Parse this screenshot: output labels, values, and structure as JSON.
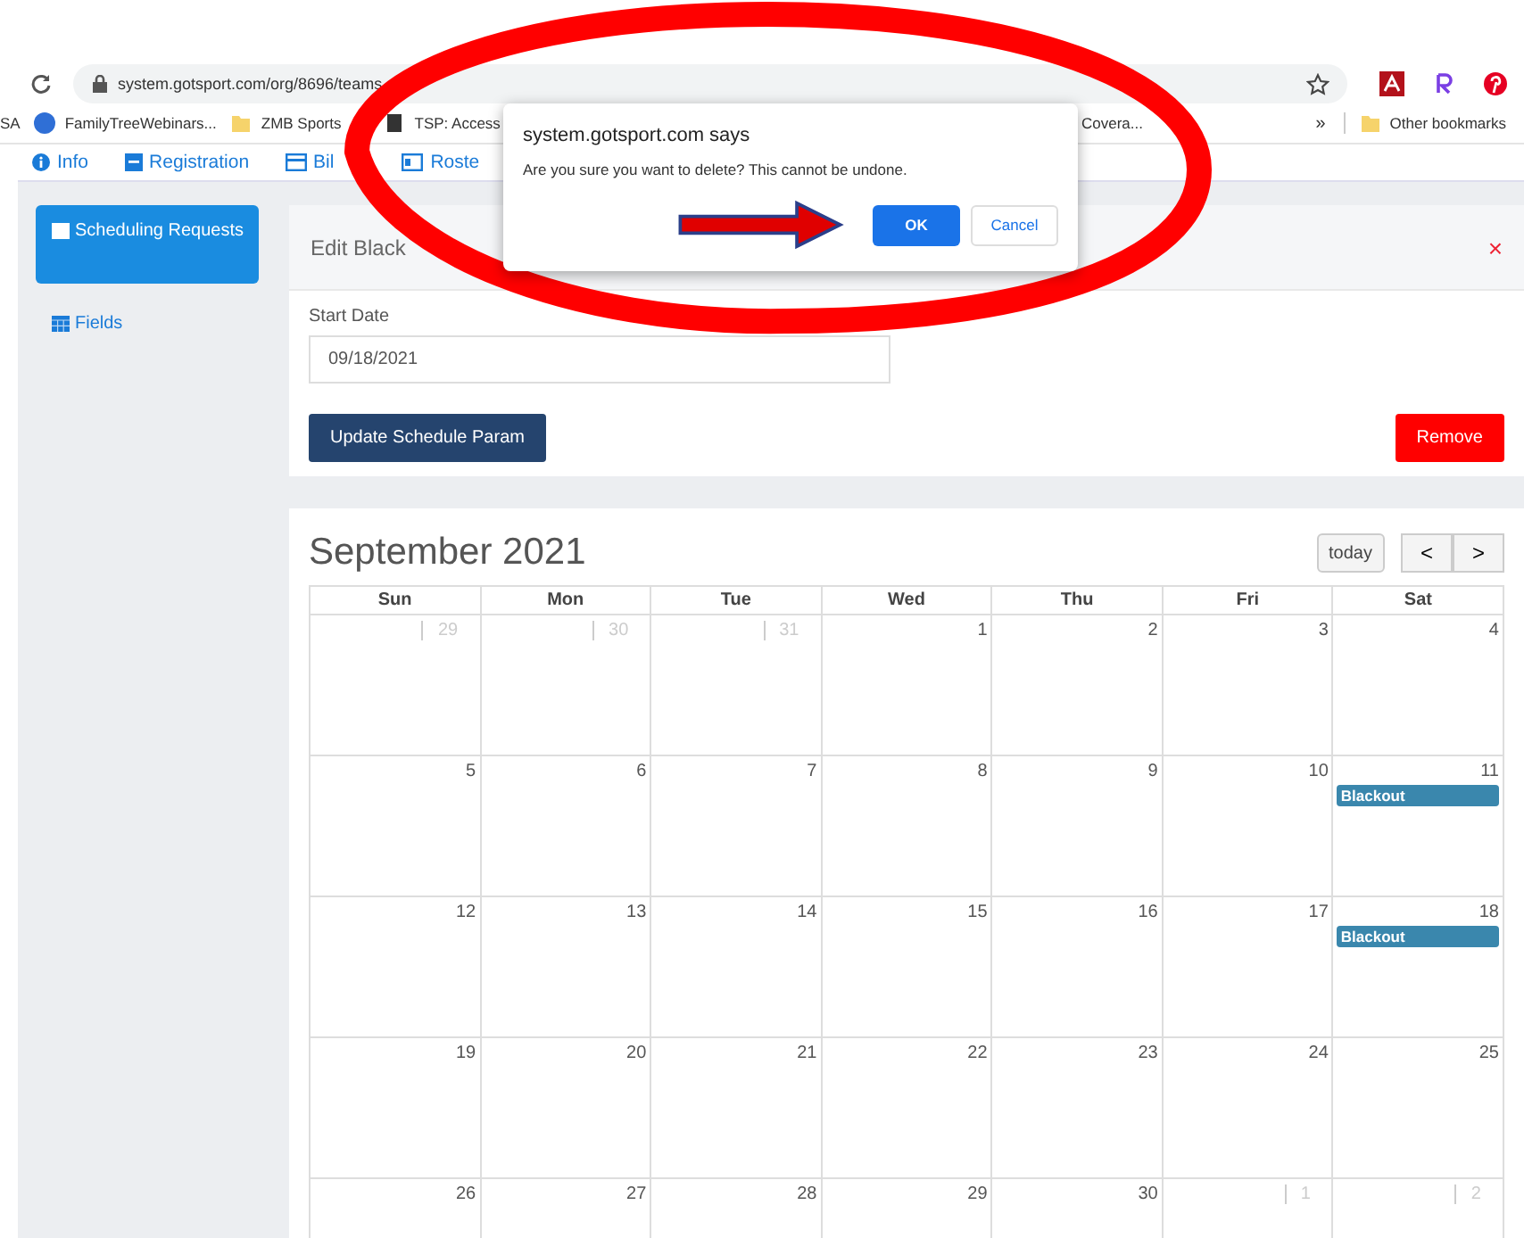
{
  "browser": {
    "url": "system.gotsport.com/org/8696/teams",
    "bookmarks": [
      {
        "label": "SA",
        "kind": "text"
      },
      {
        "label": "FamilyTreeWebinars...",
        "kind": "circle"
      },
      {
        "label": "ZMB Sports",
        "kind": "folder"
      },
      {
        "label": "TSP: Access",
        "kind": "page"
      }
    ],
    "bookmarks_right": [
      {
        "label": "Covera..."
      }
    ],
    "more": "»",
    "other_bookmarks": "Other bookmarks"
  },
  "nav_tabs": [
    {
      "label": "Info"
    },
    {
      "label": "Registration"
    },
    {
      "label": "Bil"
    },
    {
      "label": "Roste"
    }
  ],
  "sidebar": {
    "items": [
      {
        "label": "Scheduling Requests",
        "selected": true
      },
      {
        "label": "Fields",
        "selected": false
      }
    ]
  },
  "edit_panel": {
    "title": "Edit Black",
    "close": "×",
    "field_label": "Start Date",
    "field_value": "09/18/2021",
    "update_button": "Update Schedule Param",
    "remove_button": "Remove"
  },
  "calendar": {
    "title": "September 2021",
    "today_button": "today",
    "prev": "<",
    "next": ">",
    "weekdays": [
      "Sun",
      "Mon",
      "Tue",
      "Wed",
      "Thu",
      "Fri",
      "Sat"
    ],
    "weeks": [
      [
        {
          "day": "29",
          "other_month": true
        },
        {
          "day": "30",
          "other_month": true
        },
        {
          "day": "31",
          "other_month": true
        },
        {
          "day": "1",
          "other_month": false
        },
        {
          "day": "2",
          "other_month": false
        },
        {
          "day": "3",
          "other_month": false
        },
        {
          "day": "4",
          "other_month": false
        }
      ],
      [
        {
          "day": "5",
          "other_month": false
        },
        {
          "day": "6",
          "other_month": false
        },
        {
          "day": "7",
          "other_month": false
        },
        {
          "day": "8",
          "other_month": false
        },
        {
          "day": "9",
          "other_month": false
        },
        {
          "day": "10",
          "other_month": false
        },
        {
          "day": "11",
          "other_month": false,
          "event": "Blackout"
        }
      ],
      [
        {
          "day": "12",
          "other_month": false
        },
        {
          "day": "13",
          "other_month": false
        },
        {
          "day": "14",
          "other_month": false
        },
        {
          "day": "15",
          "other_month": false
        },
        {
          "day": "16",
          "other_month": false
        },
        {
          "day": "17",
          "other_month": false
        },
        {
          "day": "18",
          "other_month": false,
          "event": "Blackout"
        }
      ],
      [
        {
          "day": "19",
          "other_month": false
        },
        {
          "day": "20",
          "other_month": false
        },
        {
          "day": "21",
          "other_month": false
        },
        {
          "day": "22",
          "other_month": false
        },
        {
          "day": "23",
          "other_month": false
        },
        {
          "day": "24",
          "other_month": false
        },
        {
          "day": "25",
          "other_month": false
        }
      ],
      [
        {
          "day": "26",
          "other_month": false
        },
        {
          "day": "27",
          "other_month": false
        },
        {
          "day": "28",
          "other_month": false
        },
        {
          "day": "29",
          "other_month": false
        },
        {
          "day": "30",
          "other_month": false
        },
        {
          "day": "1",
          "other_month": true
        },
        {
          "day": "2",
          "other_month": true
        }
      ]
    ]
  },
  "dialog": {
    "title": "system.gotsport.com says",
    "message": "Are you sure you want to delete? This cannot be undone.",
    "ok": "OK",
    "cancel": "Cancel"
  }
}
